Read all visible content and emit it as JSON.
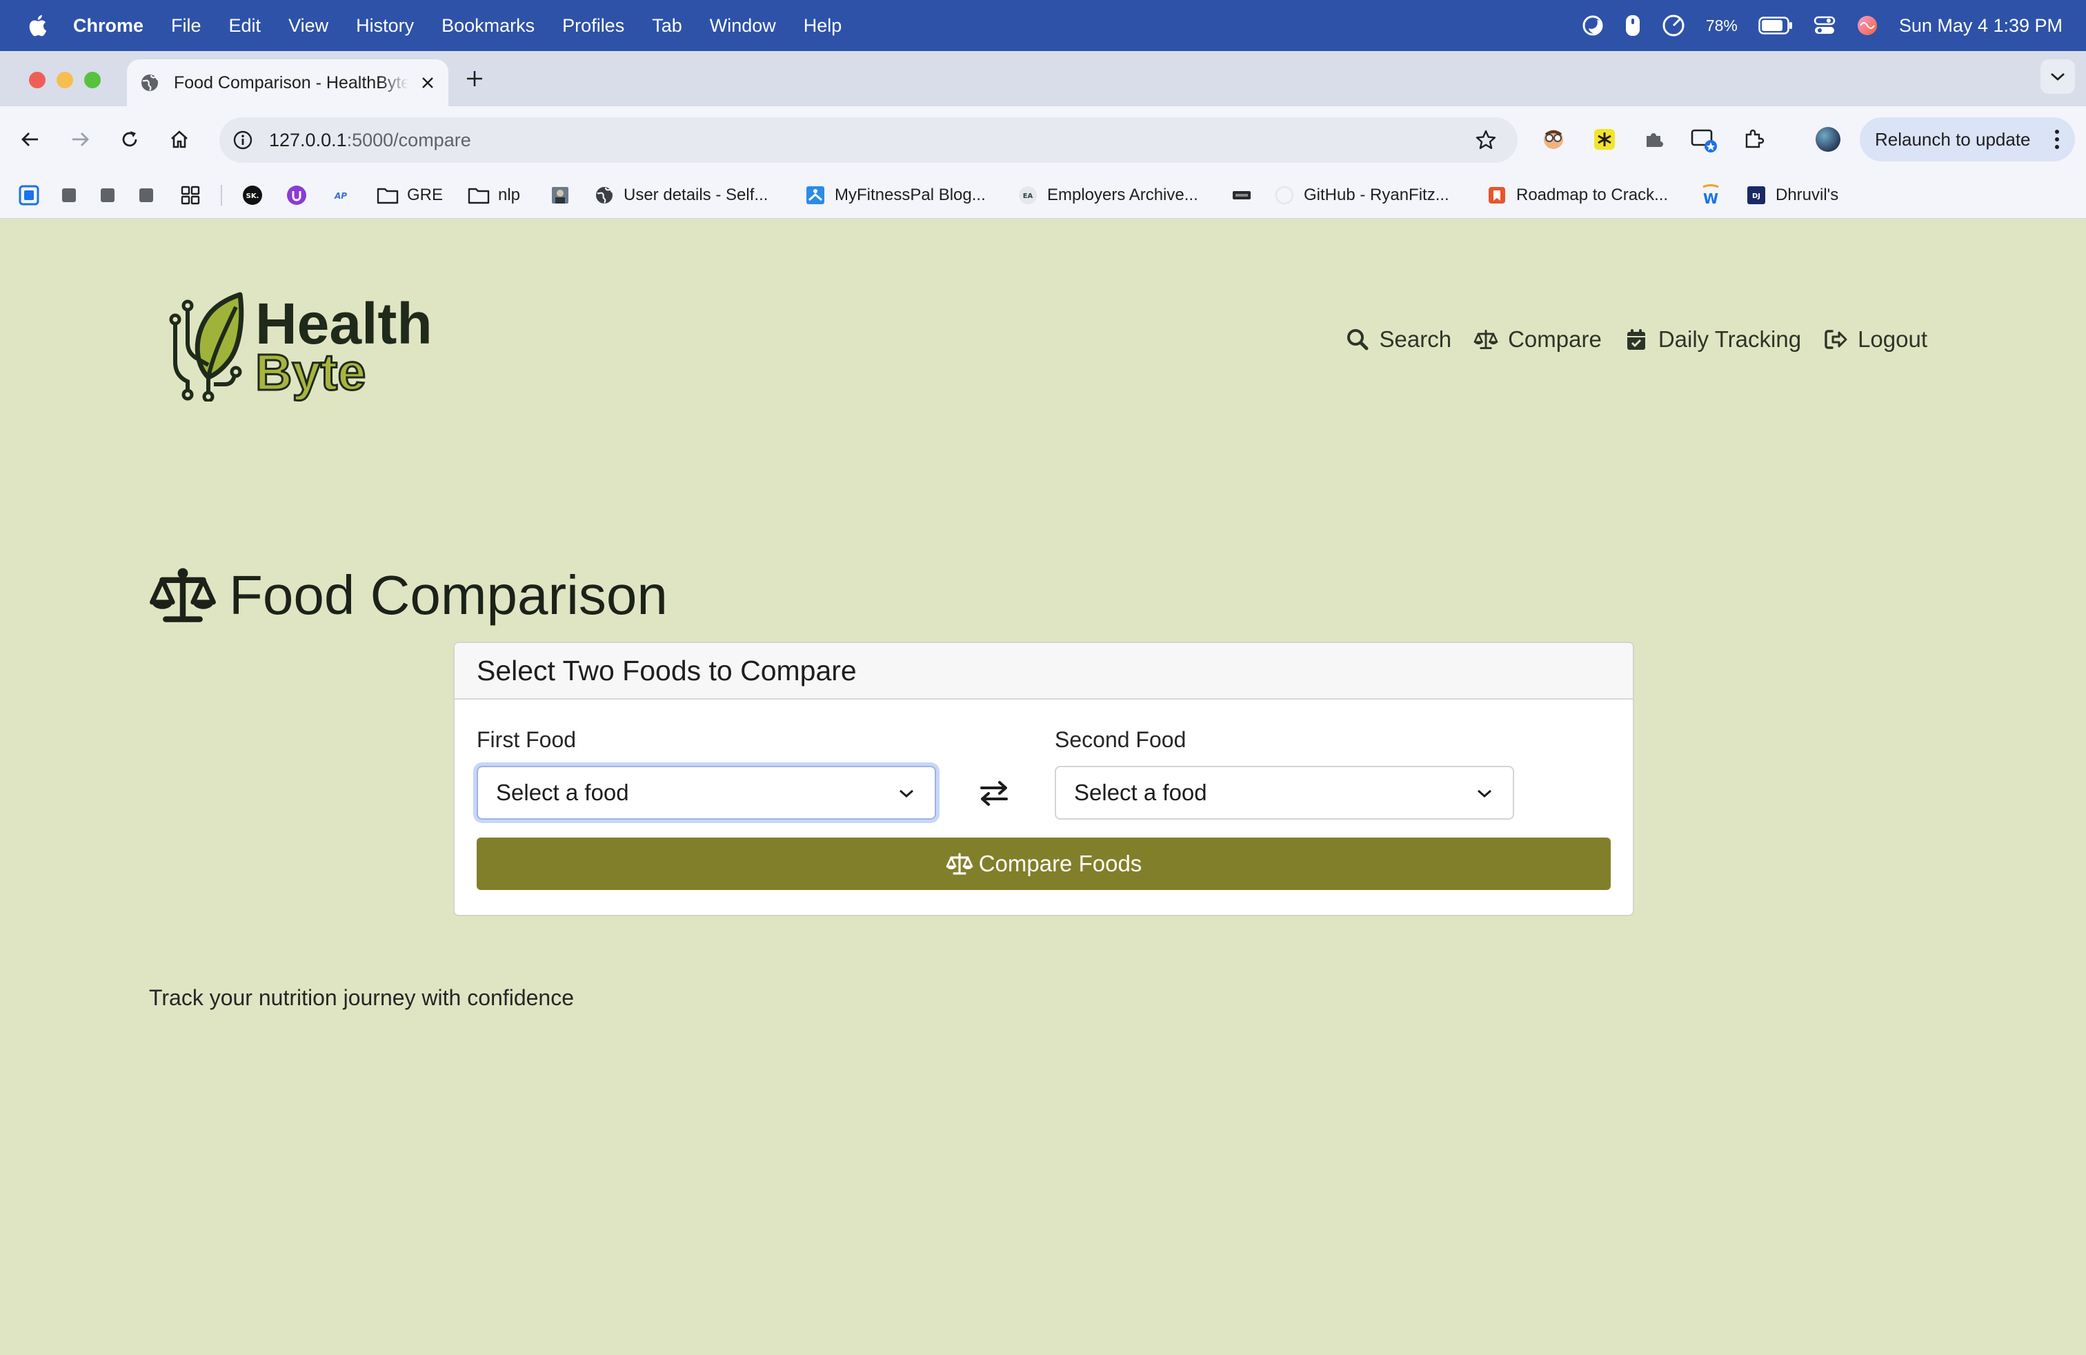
{
  "menubar": {
    "app": "Chrome",
    "items": [
      "File",
      "Edit",
      "View",
      "History",
      "Bookmarks",
      "Profiles",
      "Tab",
      "Window",
      "Help"
    ],
    "battery": "78%",
    "datetime": "Sun May 4  1:39 PM"
  },
  "browser": {
    "tab_title": "Food Comparison - HealthByte",
    "url_host": "127.0.0.1",
    "url_path": ":5000/compare",
    "relaunch_label": "Relaunch to update"
  },
  "bookmarks": {
    "gre": "GRE",
    "nlp": "nlp",
    "user_details": "User details - Self...",
    "myfitnesspal": "MyFitnessPal Blog...",
    "employers": "Employers Archive...",
    "github": "GitHub - RyanFitz...",
    "roadmap": "Roadmap to Crack...",
    "dhruvil": "Dhruvil's"
  },
  "site": {
    "logo_line1": "Health",
    "logo_line2": "Byte",
    "nav": {
      "search": "Search",
      "compare": "Compare",
      "daily": "Daily Tracking",
      "logout": "Logout"
    },
    "page_title": "Food Comparison",
    "card_header": "Select Two Foods to Compare",
    "first_label": "First Food",
    "second_label": "Second Food",
    "first_value": "Select a food",
    "second_value": "Select a food",
    "compare_button": "Compare Foods",
    "tagline": "Track your nutrition journey with confidence"
  },
  "colors": {
    "page_bg": "#dfe5c3",
    "button": "#827f2a",
    "menubar": "#2d52a8"
  }
}
